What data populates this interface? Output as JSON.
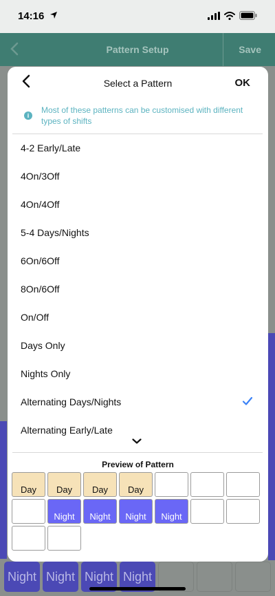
{
  "status_bar": {
    "time": "14:16"
  },
  "nav": {
    "title": "Pattern Setup",
    "save_label": "Save"
  },
  "modal": {
    "title": "Select a Pattern",
    "ok_label": "OK",
    "info_text": "Most of these patterns can be customised with different types of shifts",
    "patterns": [
      {
        "label": "4-2 Early/Late",
        "selected": false
      },
      {
        "label": "4On/3Off",
        "selected": false
      },
      {
        "label": "4On/4Off",
        "selected": false
      },
      {
        "label": "5-4 Days/Nights",
        "selected": false
      },
      {
        "label": "6On/6Off",
        "selected": false
      },
      {
        "label": "8On/6Off",
        "selected": false
      },
      {
        "label": "On/Off",
        "selected": false
      },
      {
        "label": "Days Only",
        "selected": false
      },
      {
        "label": "Nights Only",
        "selected": false
      },
      {
        "label": "Alternating Days/Nights",
        "selected": true
      },
      {
        "label": "Alternating Early/Late",
        "selected": false
      }
    ],
    "preview": {
      "title": "Preview of Pattern",
      "cells": [
        {
          "label": "Day",
          "type": "day"
        },
        {
          "label": "Day",
          "type": "day"
        },
        {
          "label": "Day",
          "type": "day"
        },
        {
          "label": "Day",
          "type": "day"
        },
        {
          "label": "",
          "type": "empty"
        },
        {
          "label": "",
          "type": "empty"
        },
        {
          "label": "",
          "type": "empty"
        },
        {
          "label": "",
          "type": "empty"
        },
        {
          "label": "Night",
          "type": "night"
        },
        {
          "label": "Night",
          "type": "night"
        },
        {
          "label": "Night",
          "type": "night"
        },
        {
          "label": "Night",
          "type": "night"
        },
        {
          "label": "",
          "type": "empty"
        },
        {
          "label": "",
          "type": "empty"
        },
        {
          "label": "",
          "type": "empty"
        },
        {
          "label": "",
          "type": "empty"
        }
      ]
    }
  },
  "background_cells": [
    {
      "label": "Night",
      "type": "night"
    },
    {
      "label": "Night",
      "type": "night"
    },
    {
      "label": "Night",
      "type": "night"
    },
    {
      "label": "Night",
      "type": "night"
    },
    {
      "label": "",
      "type": "empty"
    },
    {
      "label": "",
      "type": "empty"
    },
    {
      "label": "",
      "type": "empty"
    }
  ],
  "colors": {
    "accent": "#3b82f6",
    "info": "#5cb3c0",
    "day": "#f6e2b8",
    "night": "#6a67f6",
    "header": "#3f7d72"
  }
}
